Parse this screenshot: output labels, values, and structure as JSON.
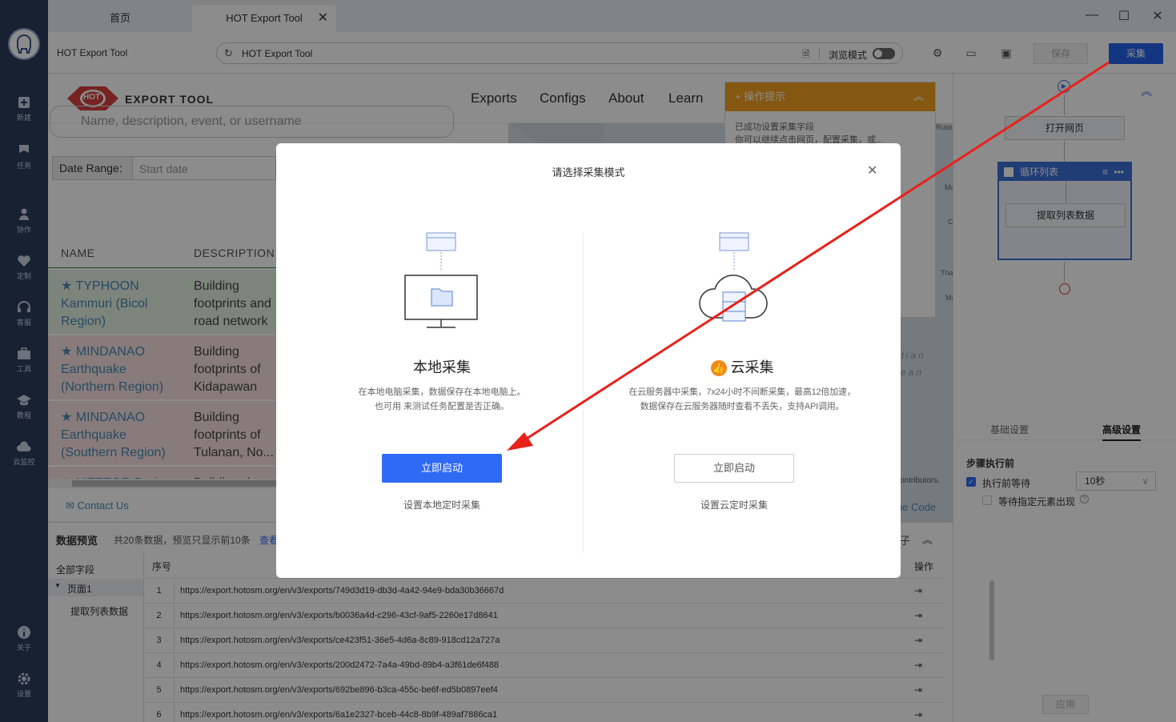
{
  "window": {
    "tabs": [
      {
        "label": "首页"
      },
      {
        "label": "HOT Export Tool"
      }
    ],
    "close_glyph": "✕"
  },
  "toolbar": {
    "page_title": "HOT Export Tool",
    "url": "HOT Export Tool",
    "browse_mode": "浏览模式",
    "save_label": "保存",
    "collect_label": "采集"
  },
  "sidebar": {
    "items": [
      {
        "label": "新建",
        "icon": "plus-square-icon"
      },
      {
        "label": "任务",
        "icon": "flag-icon"
      },
      {
        "label": "协作",
        "icon": "people-icon"
      },
      {
        "label": "定制",
        "icon": "heart-check-icon"
      },
      {
        "label": "客服",
        "icon": "headset-icon"
      },
      {
        "label": "工具",
        "icon": "toolbox-icon"
      },
      {
        "label": "教程",
        "icon": "graduation-cap-icon"
      },
      {
        "label": "云监控",
        "icon": "cloud-chart-icon"
      },
      {
        "label": "关于",
        "icon": "info-icon"
      },
      {
        "label": "设置",
        "icon": "gear-icon"
      }
    ]
  },
  "webpage": {
    "logo_badge": "HOT",
    "logo_text": "EXPORT TOOL",
    "nav": [
      "Exports",
      "Configs",
      "About",
      "Learn"
    ],
    "search_placeholder": "Name, description, event, or username",
    "date_range_label": "Date Range:",
    "date_start_placeholder": "Start date",
    "columns": [
      "NAME",
      "DESCRIPTION"
    ],
    "rows": [
      {
        "name": "★ TYPHOON Kammuri (Bicol Region)",
        "desc": "Building footprints and road network of...",
        "bg": "#e3f0e2"
      },
      {
        "name": "★ MINDANAO Earthquake (Northern Region)",
        "desc": "Building footprints of Kidapawan and...",
        "bg": "#f6e1e1"
      },
      {
        "name": "★ MINDANAO Earthquake (Southern Region)",
        "desc": "Building footprints of Tulanan, No...",
        "bg": "#f6e1e1"
      },
      {
        "name": "★ METEOR Project",
        "desc": "Building data",
        "bg": "#f6e1e1"
      }
    ],
    "contact": "Contact Us",
    "code_link": "he Code",
    "map_attribution": "ontributors.",
    "map_labels": [
      "dian",
      "ean",
      "Russ",
      "Ma",
      "C",
      "Tha",
      "Ma"
    ]
  },
  "guide": {
    "title": "操作提示",
    "body": "已成功设置采集字段\n你可以继续点击网页，配置采集，或..."
  },
  "flow": {
    "open_page": "打开网页",
    "loop": "循环列表",
    "extract": "提取列表数据"
  },
  "settings": {
    "tab_basic": "基础设置",
    "tab_advanced": "高级设置",
    "section": "步骤执行前",
    "wait_before": "执行前等待",
    "wait_value": "10秒",
    "wait_element": "等待指定元素出现",
    "apply": "应用"
  },
  "preview": {
    "title": "数据预览",
    "summary": "共20条数据，预览只显示前10条",
    "view_link": "查看",
    "all_fields": "全部字段",
    "page1": "页面1",
    "extract_field": "提取列表数据",
    "col_index": "序号",
    "col_op": "操作",
    "rows": [
      {
        "idx": "1",
        "url": "https://export.hotosm.org/en/v3/exports/749d3d19-db3d-4a42-94e9-bda30b36667d"
      },
      {
        "idx": "2",
        "url": "https://export.hotosm.org/en/v3/exports/b0036a4d-c296-43cf-9af5-2260e17d8641"
      },
      {
        "idx": "3",
        "url": "https://export.hotosm.org/en/v3/exports/ce423f51-36e5-4d6a-8c89-918cd12a727a"
      },
      {
        "idx": "4",
        "url": "https://export.hotosm.org/en/v3/exports/200d2472-7a4a-49bd-89b4-a3f61de6f488"
      },
      {
        "idx": "5",
        "url": "https://export.hotosm.org/en/v3/exports/692be896-b3ca-455c-be6f-ed5b0897eef4"
      },
      {
        "idx": "6",
        "url": "https://export.hotosm.org/en/v3/exports/6a1e2327-bceb-44c8-8b9f-489af7886ca1"
      }
    ],
    "op_glyph": "⇥",
    "trailing_char": "子"
  },
  "modal": {
    "title": "请选择采集模式",
    "local": {
      "title": "本地采集",
      "desc": "在本地电脑采集，数据保存在本地电脑上。\n也可用 来测试任务配置是否正确。",
      "button": "立即启动",
      "link": "设置本地定时采集"
    },
    "cloud": {
      "badge": "👍",
      "title": "云采集",
      "desc": "在云服务器中采集，7x24小时不间断采集，最高12倍加速，\n数据保存在云服务器随时查看不丢失，支持API调用。",
      "button": "立即启动",
      "link": "设置云定时采集"
    }
  },
  "colors": {
    "sidebar": "#2b3c5c",
    "primary": "#2f6af5",
    "annotation_arrow": "#e8211b",
    "guide_header": "#f0a020"
  }
}
